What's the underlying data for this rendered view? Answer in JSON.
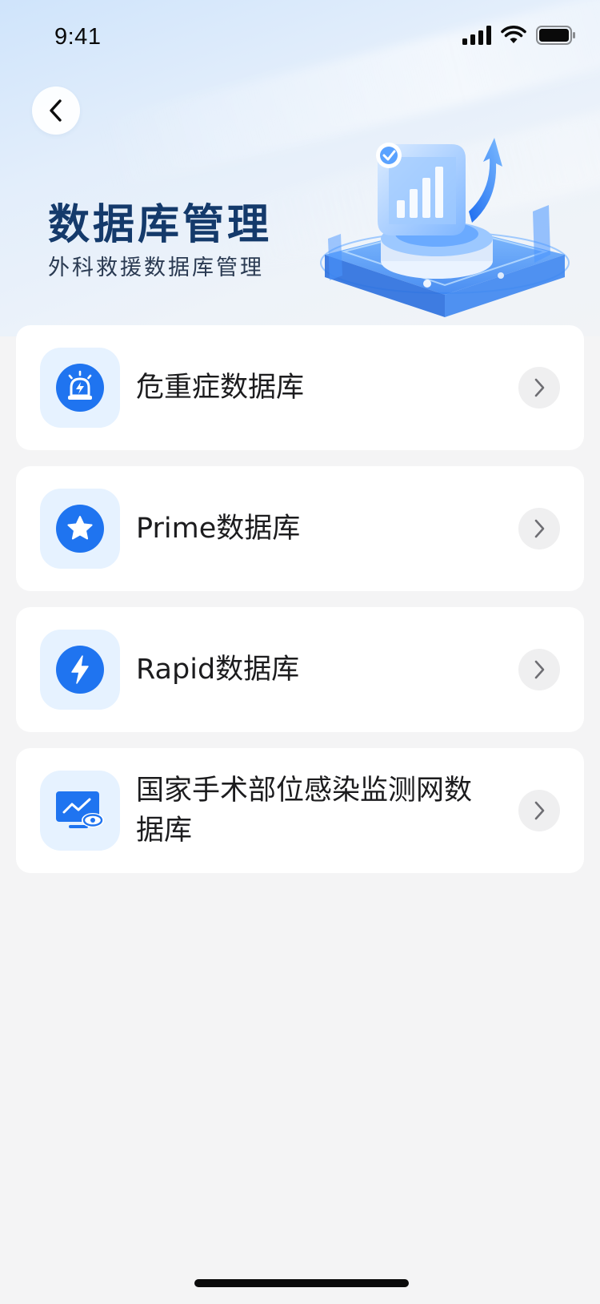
{
  "status_bar": {
    "time": "9:41",
    "icons": [
      "cellular-signal-icon",
      "wifi-icon",
      "battery-icon"
    ]
  },
  "header": {
    "back_icon": "chevron-left-icon",
    "title": "数据库管理",
    "subtitle": "外科救援数据库管理",
    "illustration": "database-analytics-illustration"
  },
  "databases": [
    {
      "label": "危重症数据库",
      "icon": "alarm-siren-icon"
    },
    {
      "label": "Prime数据库",
      "icon": "star-icon"
    },
    {
      "label": "Rapid数据库",
      "icon": "lightning-icon"
    },
    {
      "label": "国家手术部位感染监测网数据库",
      "icon": "monitor-eye-icon"
    }
  ],
  "colors": {
    "accent": "#1f74f0",
    "icon_tile": "#e6f2ff",
    "title": "#143a6b",
    "background": "#f4f4f5"
  }
}
